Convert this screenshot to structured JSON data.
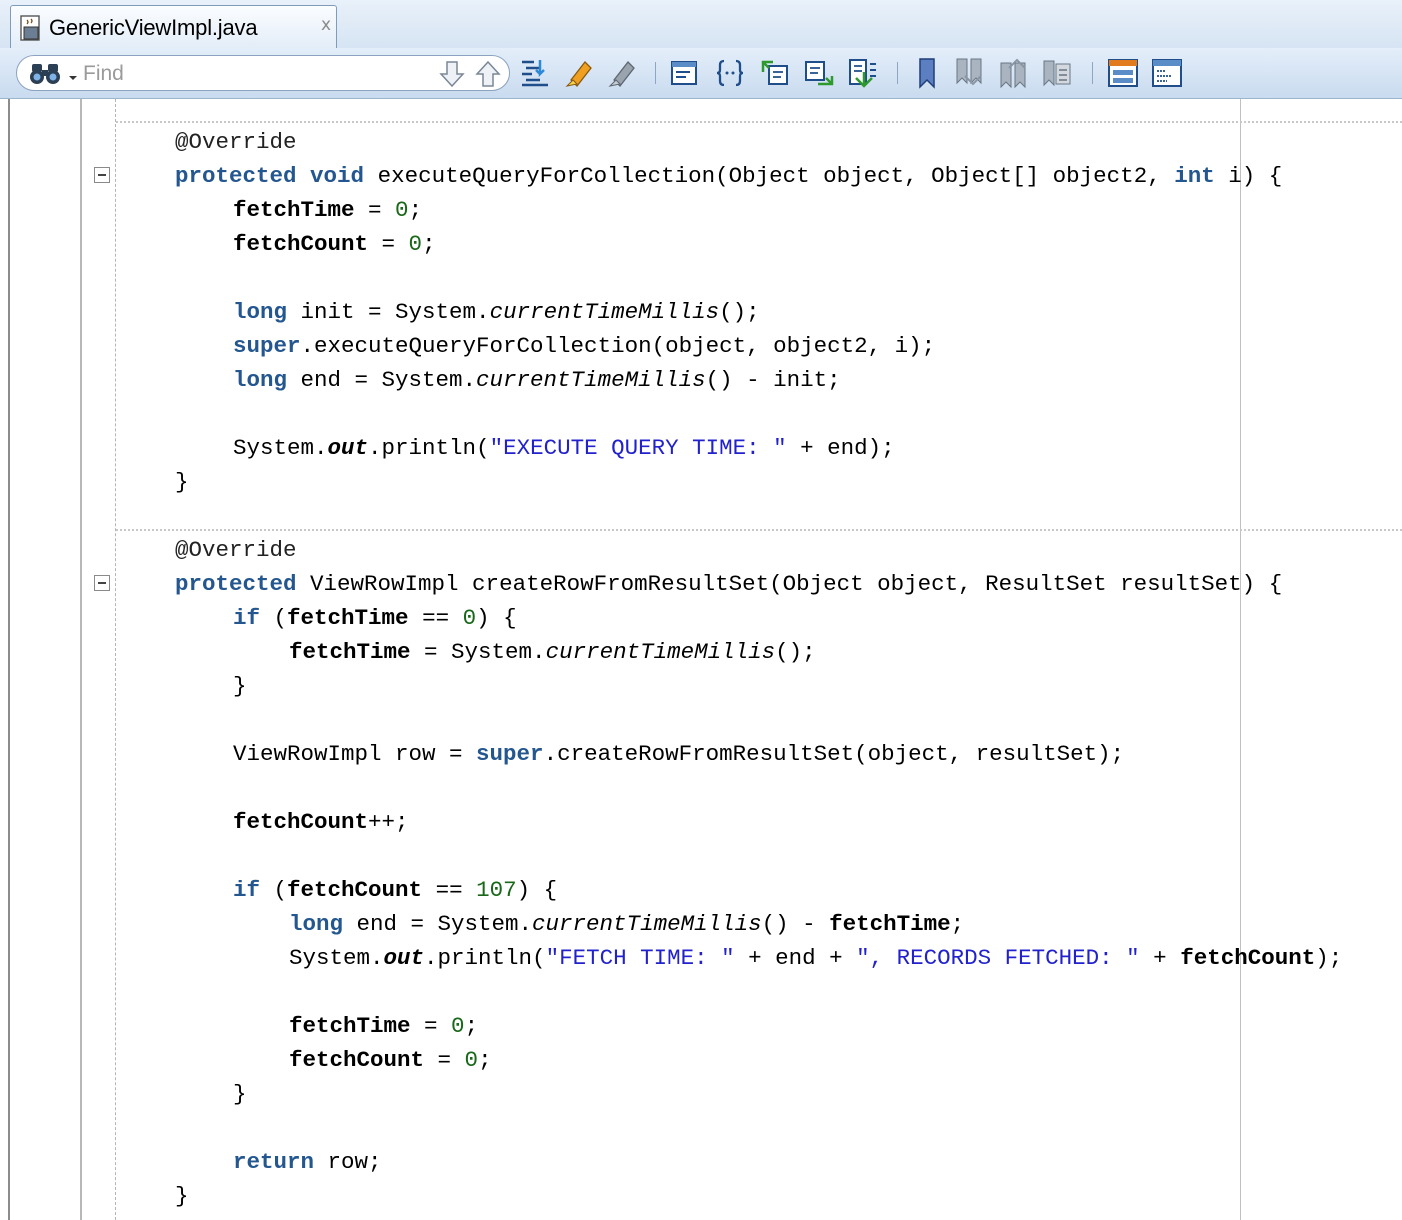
{
  "tab": {
    "title": "GenericViewImpl.java",
    "close_glyph": "x",
    "icon": "java-file-icon"
  },
  "toolbar": {
    "find_placeholder": "Find",
    "icons": [
      "find-next-icon",
      "find-previous-icon",
      "goto-line-icon",
      "highlight-icon",
      "clear-highlight-icon",
      "insert-code-icon",
      "braces-icon",
      "source-back-icon",
      "source-forward-icon",
      "last-edit-icon",
      "bookmark-icon",
      "next-bookmark-icon",
      "previous-bookmark-icon",
      "bookmark-list-icon",
      "split-view-icon",
      "toggle-panel-icon"
    ]
  },
  "code": {
    "m1": {
      "annotation": "@Override",
      "kw_protected": "protected",
      "kw_void": "void",
      "signature_a": " executeQueryForCollection(Object object, Object[] object2, ",
      "kw_int": "int",
      "signature_b": " i) {",
      "fetch_time": "fetchTime",
      "fetch_count": "fetchCount",
      "assign": " = ",
      "zero": "0",
      "semi": ";",
      "kw_long": "long",
      "init_a": " init = System.",
      "current_millis": "currentTimeMillis",
      "call_end": "();",
      "kw_super": "super",
      "super_call": ".executeQueryForCollection(object, object2, i);",
      "end_a": " end = System.",
      "end_b": "() - init;",
      "sysout_a": "System.",
      "out": "out",
      "println_a": ".println(",
      "str_query": "\"EXECUTE QUERY TIME: \"",
      "println_b": " + end);",
      "close_brace": "}"
    },
    "m2": {
      "annotation": "@Override",
      "kw_protected": "protected",
      "signature": " ViewRowImpl createRowFromResultSet(Object object, ResultSet resultSet) {",
      "kw_if": "if",
      "paren_open": " (",
      "eq_zero_a": " == ",
      "zero": "0",
      "if_close": ") {",
      "fetch_time": "fetchTime",
      "fetch_count": "fetchCount",
      "assign_sys": " = System.",
      "current_millis": "currentTimeMillis",
      "call_end": "();",
      "close_brace": "}",
      "row_a": "ViewRowImpl row = ",
      "kw_super": "super",
      "row_b": ".createRowFromResultSet(object, resultSet);",
      "increment": "++;",
      "eq": " == ",
      "limit": "107",
      "kw_long": "long",
      "end_a": " end = System.",
      "end_b": "() - ",
      "semi": ";",
      "sysout_a": "System.",
      "out": "out",
      "println_a": ".println(",
      "str_fetch": "\"FETCH TIME: \"",
      "plus_end": " + end + ",
      "str_records": "\", RECORDS FETCHED: \"",
      "plus": " + ",
      "println_end": ");",
      "assign": " = ",
      "kw_return": "return",
      "return_b": " row;"
    }
  }
}
